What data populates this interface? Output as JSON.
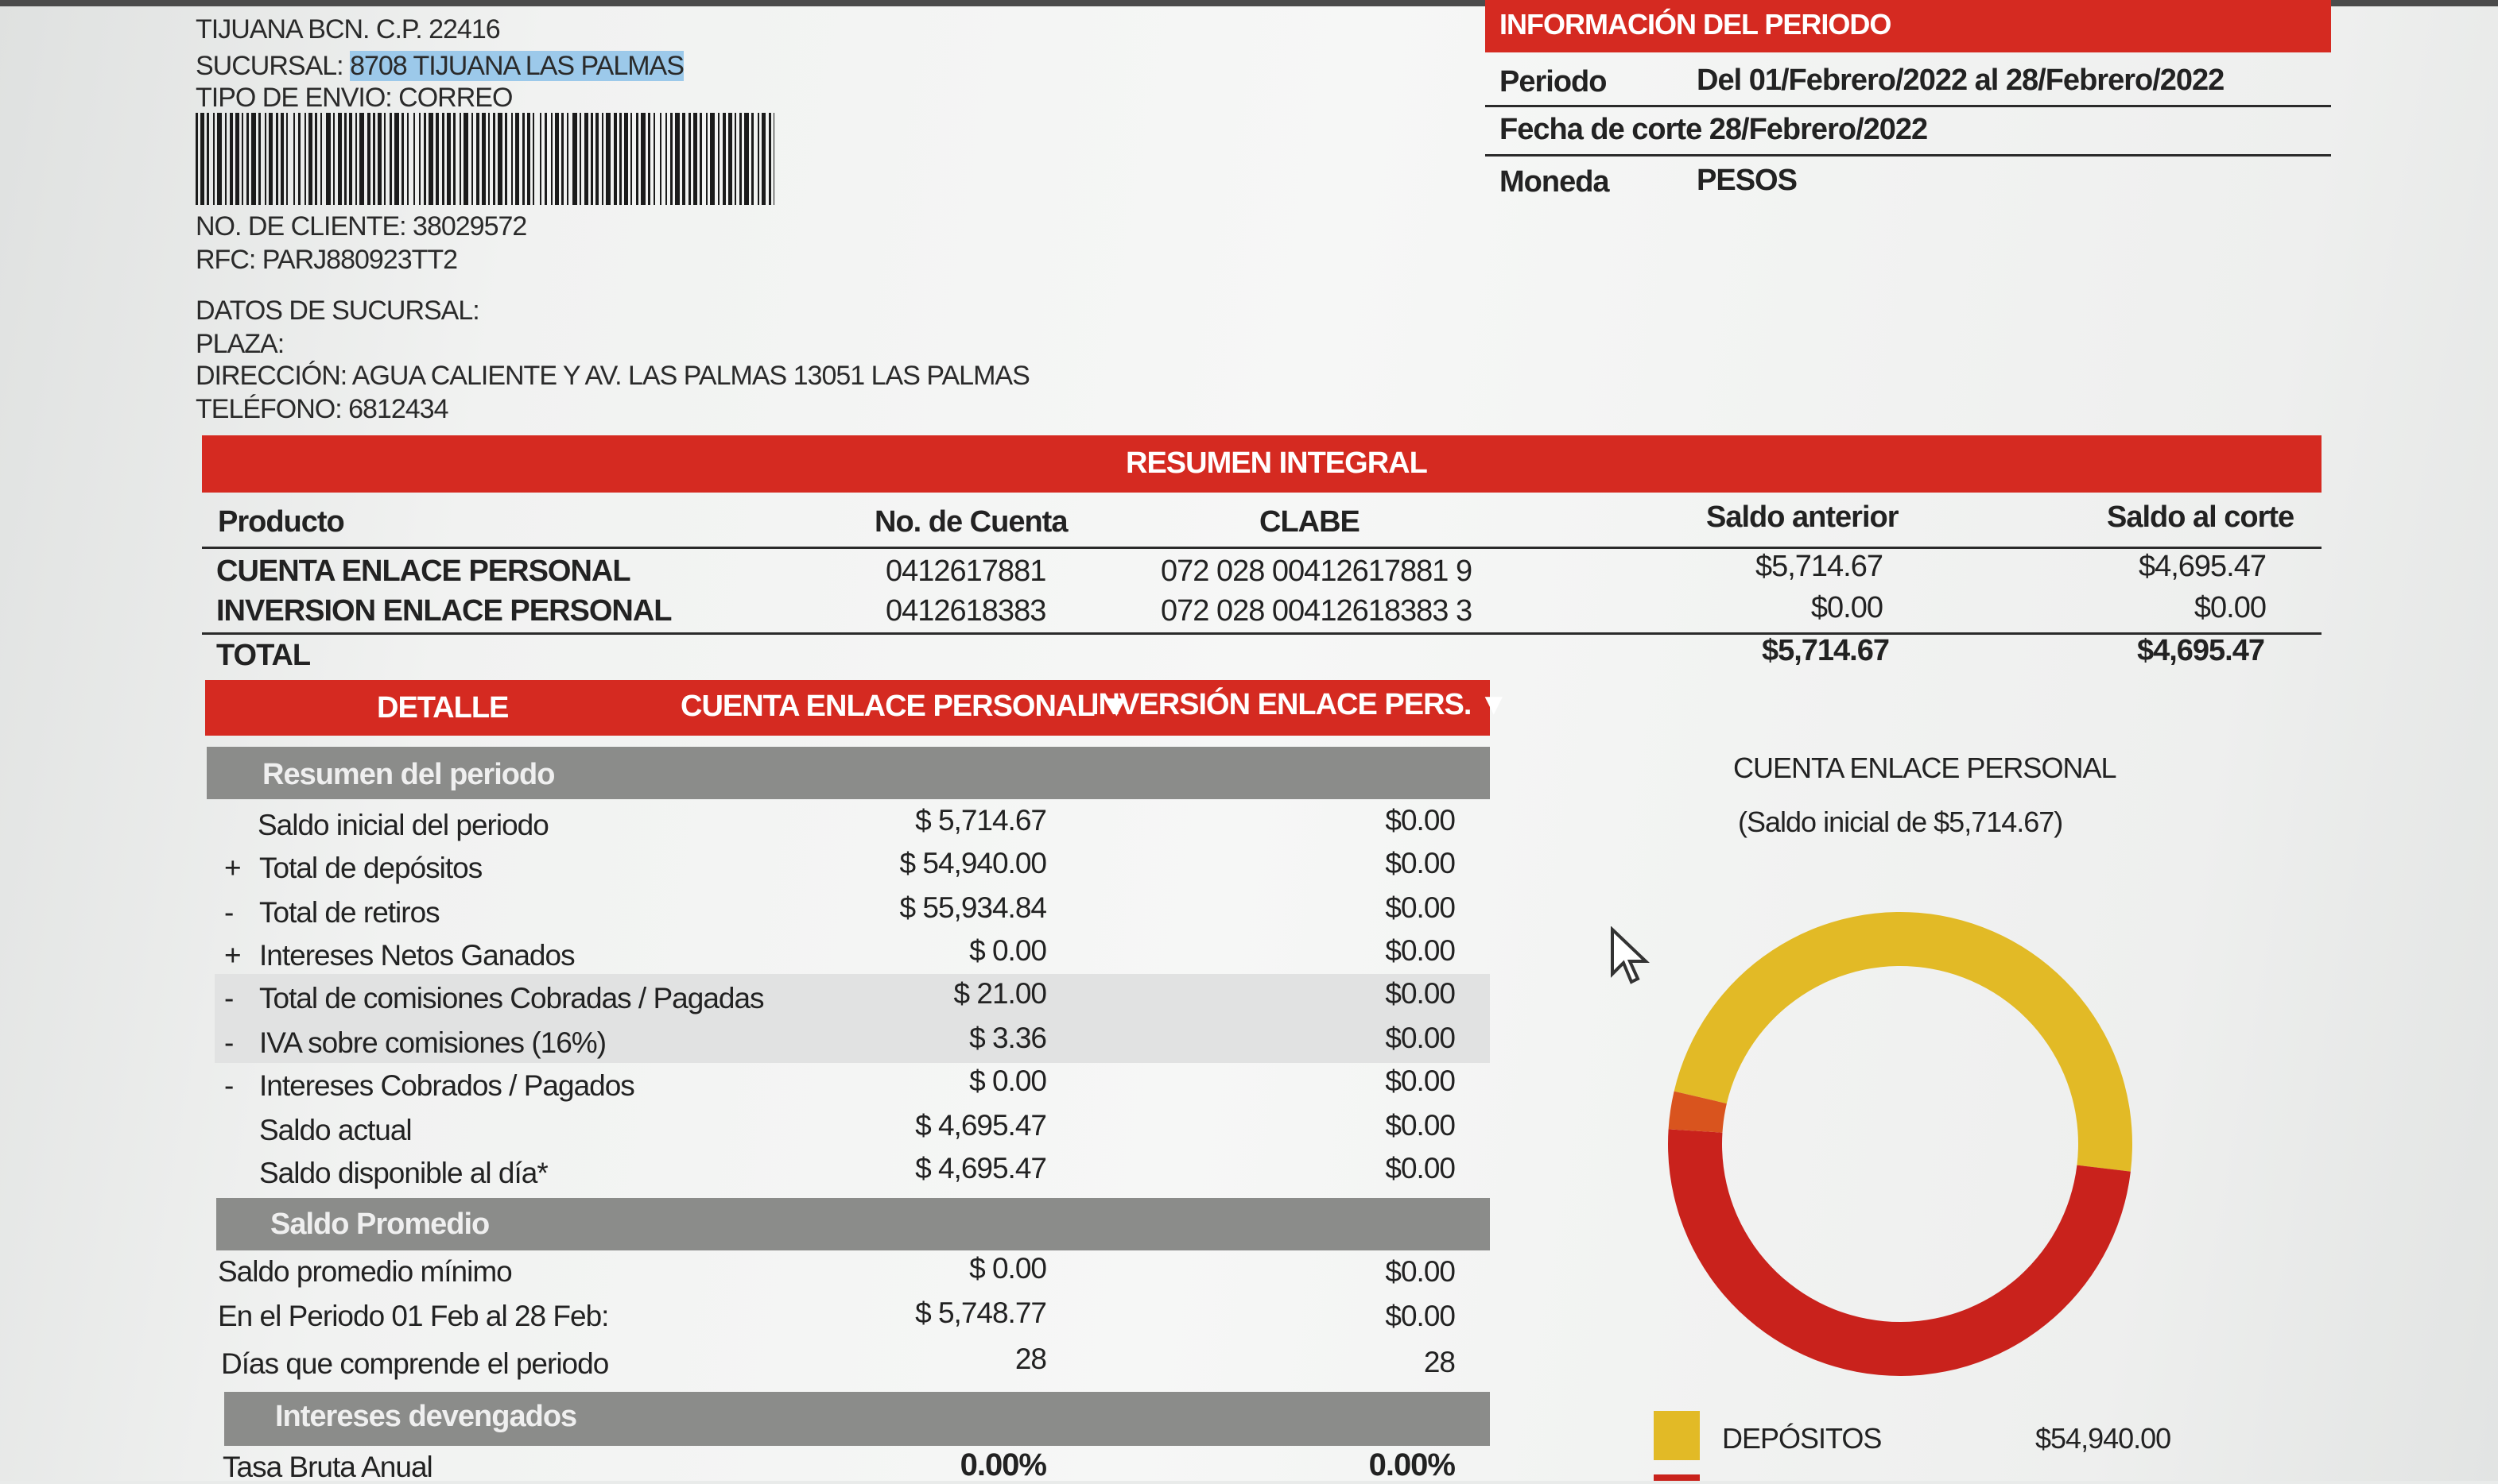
{
  "address": {
    "city_line": "TIJUANA BCN. C.P. 22416",
    "sucursal_label": "SUCURSAL: ",
    "sucursal_value": "8708 TIJUANA LAS PALMAS",
    "envio": "TIPO DE ENVIO: CORREO",
    "cliente": "NO. DE CLIENTE: 38029572",
    "rfc": "RFC: PARJ880923TT2",
    "datos_sucursal": "DATOS DE SUCURSAL:",
    "plaza": "PLAZA:",
    "direccion": "DIRECCIÓN: AGUA CALIENTE Y AV. LAS PALMAS 13051 LAS PALMAS",
    "telefono": "TELÉFONO: 6812434"
  },
  "periodo_info": {
    "header": "INFORMACIÓN DEL PERIODO",
    "rows": [
      {
        "label": "Periodo",
        "value": "Del 01/Febrero/2022 al 28/Febrero/2022"
      },
      {
        "label": "Fecha de corte 28/Febrero/2022",
        "value": ""
      },
      {
        "label": "Moneda",
        "value": "PESOS"
      }
    ]
  },
  "resumen": {
    "header": "RESUMEN INTEGRAL",
    "columns": [
      "Producto",
      "No. de Cuenta",
      "CLABE",
      "Saldo anterior",
      "Saldo al corte"
    ],
    "rows": [
      {
        "producto": "CUENTA ENLACE PERSONAL",
        "cuenta": "0412617881",
        "clabe": "072 028 00412617881 9",
        "anterior": "$5,714.67",
        "corte": "$4,695.47"
      },
      {
        "producto": "INVERSION ENLACE PERSONAL",
        "cuenta": "0412618383",
        "clabe": "072 028 00412618383 3",
        "anterior": "$0.00",
        "corte": "$0.00"
      }
    ],
    "total_label": "TOTAL",
    "total_anterior": "$5,714.67",
    "total_corte": "$4,695.47"
  },
  "detalle": {
    "header_detalle": "DETALLE",
    "header_col1": "CUENTA ENLACE PERSONAL ▼",
    "header_col2": "INVERSIÓN ENLACE PERS. ▼",
    "section_resumen": "Resumen del periodo",
    "rows": [
      {
        "sign": "",
        "label": "Saldo inicial del periodo",
        "v1": "$ 5,714.67",
        "v2": "$0.00"
      },
      {
        "sign": "+",
        "label": "Total de depósitos",
        "v1": "$ 54,940.00",
        "v2": "$0.00"
      },
      {
        "sign": "-",
        "label": "Total de retiros",
        "v1": "$ 55,934.84",
        "v2": "$0.00"
      },
      {
        "sign": "+",
        "label": "Intereses Netos Ganados",
        "v1": "$ 0.00",
        "v2": "$0.00"
      },
      {
        "sign": "-",
        "label": "Total de comisiones Cobradas / Pagadas",
        "v1": "$ 21.00",
        "v2": "$0.00"
      },
      {
        "sign": "-",
        "label": "IVA sobre comisiones (16%)",
        "v1": "$ 3.36",
        "v2": "$0.00"
      },
      {
        "sign": "-",
        "label": "Intereses Cobrados / Pagados",
        "v1": "$ 0.00",
        "v2": "$0.00"
      },
      {
        "sign": "",
        "label": "Saldo actual",
        "v1": "$ 4,695.47",
        "v2": "$0.00"
      },
      {
        "sign": "",
        "label": "Saldo disponible al día*",
        "v1": "$ 4,695.47",
        "v2": "$0.00"
      }
    ],
    "section_promedio": "Saldo Promedio",
    "promedio_rows": [
      {
        "label": "Saldo promedio mínimo",
        "v1": "$ 0.00",
        "v2": "$0.00"
      },
      {
        "label": "En el Periodo 01 Feb al 28 Feb:",
        "v1": "$ 5,748.77",
        "v2": "$0.00"
      },
      {
        "label": "Días que comprende el periodo",
        "v1": "28",
        "v2": "28"
      }
    ],
    "section_intereses": "Intereses devengados",
    "tasa_label": "Tasa Bruta Anual",
    "tasa_v1": "0.00%",
    "tasa_v2": "0.00%"
  },
  "chart": {
    "title": "CUENTA ENLACE PERSONAL",
    "subtitle": "(Saldo inicial de $5,714.67)",
    "legend": [
      {
        "label": "DEPÓSITOS",
        "value": "$54,940.00",
        "color": "#e2ba26"
      }
    ]
  },
  "chart_data": {
    "type": "pie",
    "title": "CUENTA ENLACE PERSONAL",
    "subtitle": "(Saldo inicial de $5,714.67)",
    "slices": [
      {
        "label": "DEPÓSITOS",
        "value": 54940.0,
        "color": "#e2ba26"
      },
      {
        "label": "",
        "value": 55934.84,
        "color": "#c9221c"
      },
      {
        "label": "",
        "value": 3000,
        "color": "#d9541e"
      }
    ]
  }
}
